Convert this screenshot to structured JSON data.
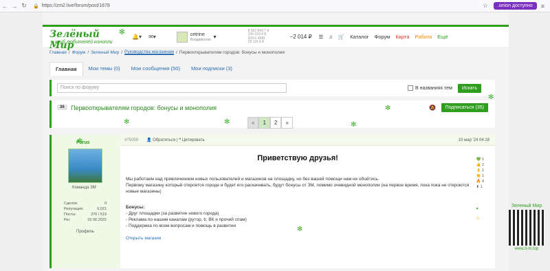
{
  "browser": {
    "url": "https://zm2.live/forum/post/1678",
    "onion": ".onion доступно"
  },
  "header": {
    "logo_title": "Зелёный Мир",
    "logo_sub": "клуб любителей конопли",
    "user_name": "cetrine",
    "user_city": "Владивосток",
    "rates": [
      "8 562 843.7 ₽",
      "104 310.4 $",
      "304.6 XMR",
      "28 115.4 ₽"
    ],
    "balance": "−2 014 ₽",
    "links": [
      "Каталог",
      "Форум",
      "Карта",
      "Работа",
      "Ещё"
    ]
  },
  "breadcrumbs": [
    "Главная",
    "Форум",
    "Зеленый Мир",
    "Руководства магазинам",
    "Первооткрывателям городов: бонусы и монополия"
  ],
  "tabs": [
    "Главная",
    "Мои темы (0)",
    "Мои сообщения (50)",
    "Мои подписки (3)"
  ],
  "search": {
    "placeholder": "Поиск по форуму",
    "checkbox_label": "В названиях тем",
    "button": "Искать"
  },
  "topic": {
    "count": "36",
    "title": "Первооткрывателям городов: бонусы и монополия",
    "subscribe": "Подписаться (35)"
  },
  "pager": {
    "prev": "«",
    "pages": [
      "1",
      "2"
    ],
    "next": "»"
  },
  "post": {
    "author": "Parus",
    "team": "Команда ЗМ",
    "stats": [
      [
        "Сделок:",
        "0"
      ],
      [
        "Репутация:",
        "6,021"
      ],
      [
        "Посты:",
        "370 / 519"
      ],
      [
        "Рег.",
        "02.06.2022"
      ]
    ],
    "profile": "Профиль",
    "number": "#75059",
    "reply": "Обратиться",
    "quote": "Цитировать",
    "date": "10 мар '24 04:18",
    "heading": "Приветствую друзья!",
    "p1": "Мы работаем над привлечением новых пользователей и магазинов на площадку, но без вашей помощи нам не обойтись.",
    "p2": "Первому магазину который откроется городе и будет его раскачивать, будут бонусы от ЗМ, помимо очевидной монополии (на первое время, пока пока не откроются новые магазины)",
    "bonus_title": "Бонусы:",
    "bonus1": "- Друг площадки (за развитие нового города)",
    "bonus2": "- Реклама по нашим каналам (рутор, tг, ВК и прочий спам)",
    "bonus3": "- Поддержка по всем вопросам и помощь в развитии",
    "link": "Открыть магазин"
  },
  "reactions": [
    "1",
    "2",
    "1",
    "1",
    "4",
    "1"
  ],
  "qr": {
    "title": "Зеленый Мир",
    "url": "www.3-m.top"
  }
}
